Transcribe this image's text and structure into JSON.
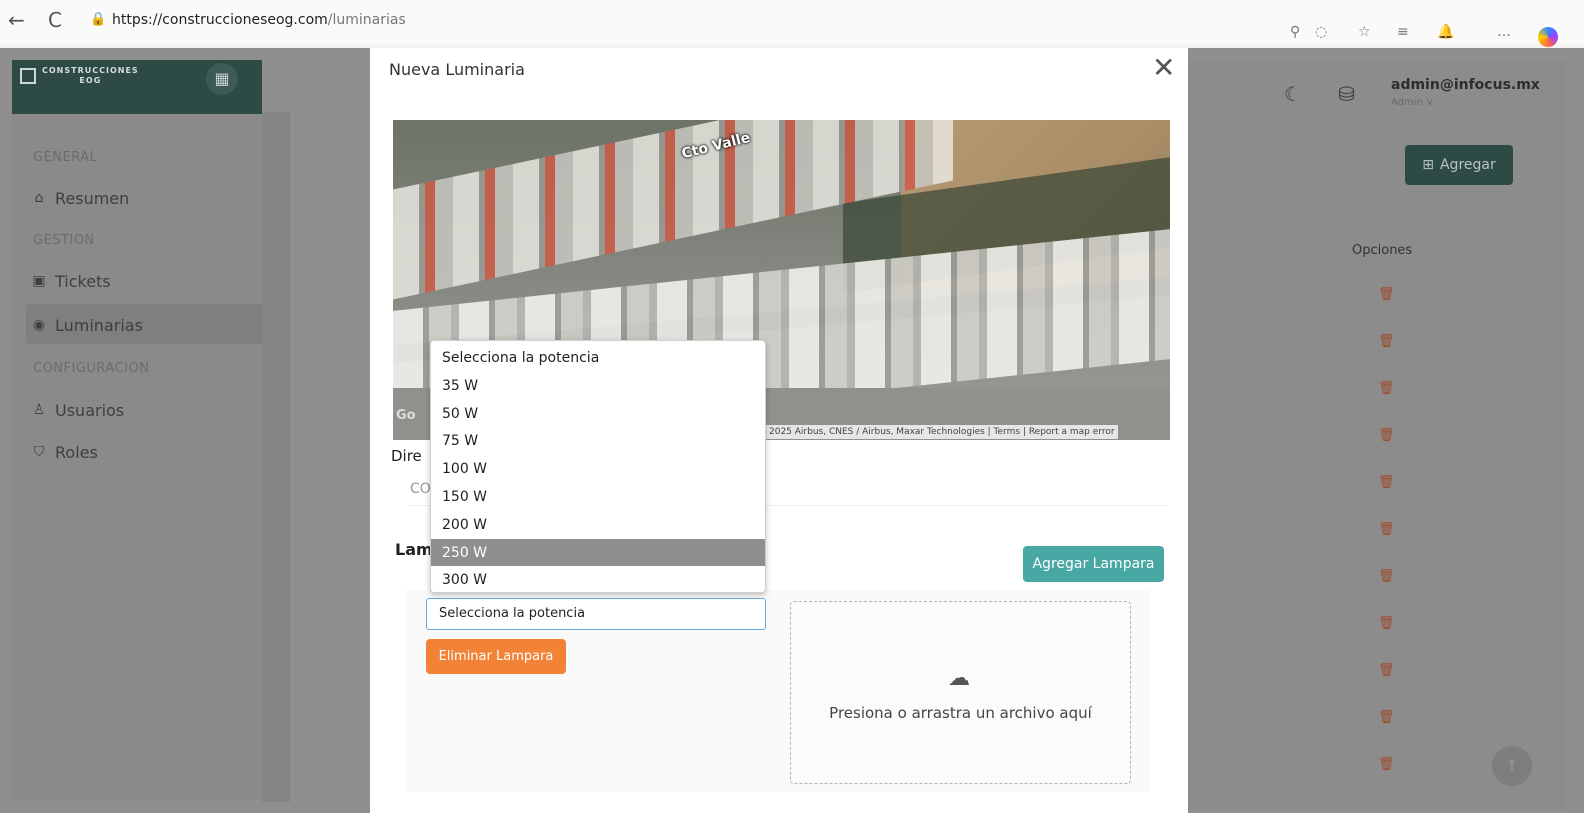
{
  "browser": {
    "back": "←",
    "reload": "C",
    "url_host": "https://construccioneseog.com",
    "url_path": "/luminarias"
  },
  "sidebar": {
    "logo_line1": "CONSTRUCCIONES",
    "logo_line2": "EOG",
    "sections": [
      "GENERAL",
      "GESTION",
      "CONFIGURACION"
    ],
    "items": [
      {
        "label": "Resumen",
        "icon": "home-icon"
      },
      {
        "label": "Tickets",
        "icon": "ticket-icon"
      },
      {
        "label": "Luminarias",
        "icon": "lamp-icon",
        "active": true
      },
      {
        "label": "Usuarios",
        "icon": "user-icon"
      },
      {
        "label": "Roles",
        "icon": "shield-icon"
      }
    ]
  },
  "header": {
    "user_email": "admin@infocus.mx",
    "user_role": "Admin ∨",
    "add_label": "Agregar"
  },
  "table": {
    "options_header": "Opciones"
  },
  "modal": {
    "title": "Nueva Luminaria",
    "close": "✕",
    "map_label": "Cto Valle",
    "map_logo": "Go",
    "map_attribution": "2025 Airbus, CNES / Airbus, Maxar Technologies | Terms | Report a map error",
    "address_label": "Dire",
    "address_value": "CO",
    "lamps_heading": "Lam",
    "add_lamp_label": "Agregar Lampara",
    "power_select_value": "Selecciona la potencia",
    "delete_lamp_label": "Eliminar Lampara",
    "dropzone_text": "Presiona o arrastra un archivo aquí"
  },
  "dropdown": {
    "options": [
      "Selecciona la potencia",
      "35 W",
      "50 W",
      "75 W",
      "100 W",
      "150 W",
      "200 W",
      "250 W",
      "300 W"
    ],
    "highlighted": "250 W"
  },
  "colors": {
    "brand": "#2e4a44",
    "teal_button": "#47a7a3",
    "orange_button": "#f28235"
  }
}
